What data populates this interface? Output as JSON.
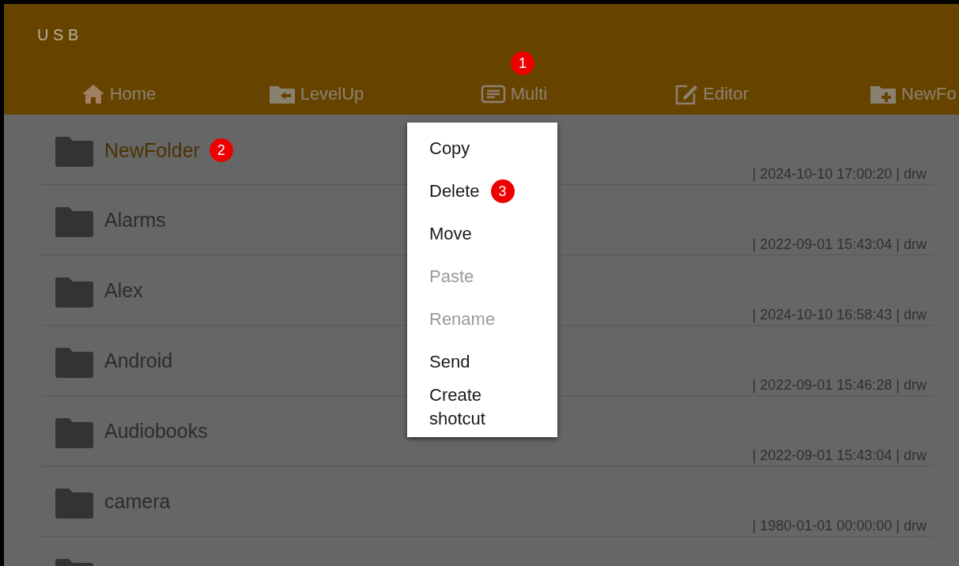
{
  "header": {
    "title": "U S B"
  },
  "toolbar": [
    {
      "kind": "home",
      "label": "Home"
    },
    {
      "kind": "levelup",
      "label": "LevelUp"
    },
    {
      "kind": "multi",
      "label": "Multi",
      "badge": "1"
    },
    {
      "kind": "editor",
      "label": "Editor"
    },
    {
      "kind": "newfolder",
      "label": "NewFo"
    }
  ],
  "files": [
    {
      "name": "NewFolder",
      "selected": true,
      "badge": "2",
      "info": "| 2024-10-10 17:00:20 | drw"
    },
    {
      "name": "Alarms",
      "selected": false,
      "info": "| 2022-09-01 15:43:04 | drw"
    },
    {
      "name": "Alex",
      "selected": false,
      "info": "| 2024-10-10 16:58:43 | drw"
    },
    {
      "name": "Android",
      "selected": false,
      "info": "| 2022-09-01 15:46:28 | drw"
    },
    {
      "name": "Audiobooks",
      "selected": false,
      "info": "| 2022-09-01 15:43:04 | drw"
    },
    {
      "name": "camera",
      "selected": false,
      "info": "| 1980-01-01 00:00:00 | drw"
    }
  ],
  "partial_row": true,
  "menu": [
    {
      "label": "Copy",
      "disabled": false
    },
    {
      "label": "Delete",
      "disabled": false,
      "badge": "3"
    },
    {
      "label": "Move",
      "disabled": false
    },
    {
      "label": "Paste",
      "disabled": true
    },
    {
      "label": "Rename",
      "disabled": true
    },
    {
      "label": "Send",
      "disabled": false
    },
    {
      "label": "Create shotcut",
      "disabled": false
    }
  ]
}
